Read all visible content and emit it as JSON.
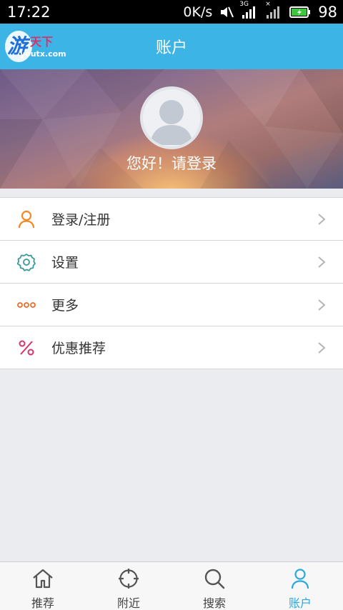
{
  "status_bar": {
    "time": "17:22",
    "net_speed": "0K/s",
    "signal_1_label": "3G",
    "signal_2_label": "×",
    "battery": "98"
  },
  "header": {
    "title": "账户",
    "logo_main": "游",
    "logo_text": "天下",
    "logo_sub": "youtx.com"
  },
  "hero": {
    "greeting": "您好！请登录"
  },
  "menu": {
    "items": [
      {
        "label": "登录/注册",
        "icon": "user-icon",
        "color": "#f08a24"
      },
      {
        "label": "设置",
        "icon": "gear-icon",
        "color": "#3a9a9a"
      },
      {
        "label": "更多",
        "icon": "more-icon",
        "color": "#f06a2a"
      },
      {
        "label": "优惠推荐",
        "icon": "percent-icon",
        "color": "#d9326b"
      }
    ]
  },
  "tabbar": {
    "tabs": [
      {
        "label": "推荐",
        "icon": "home-icon"
      },
      {
        "label": "附近",
        "icon": "target-icon"
      },
      {
        "label": "搜索",
        "icon": "search-icon"
      },
      {
        "label": "账户",
        "icon": "account-icon"
      }
    ],
    "active_tab": "账户"
  },
  "colors": {
    "header": "#3cb4e5",
    "active_tab": "#2aa8e0",
    "background": "#ebecf0"
  }
}
